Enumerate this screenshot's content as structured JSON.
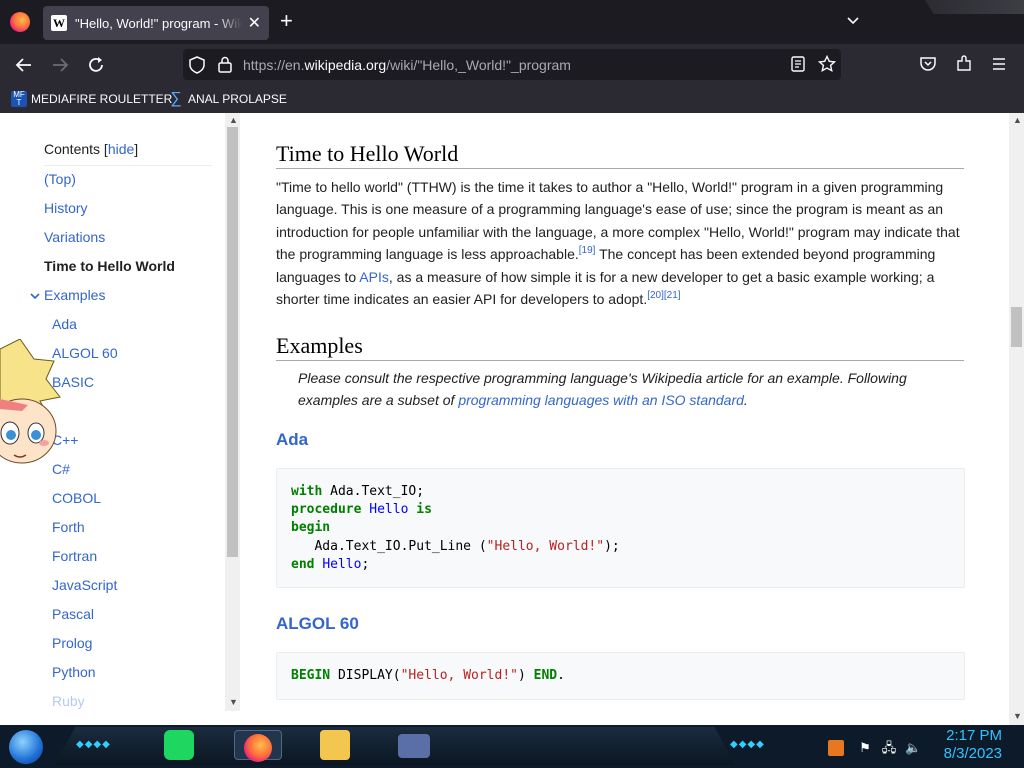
{
  "browser": {
    "tab_title": "\"Hello, World!\" program - Wikip",
    "tab_favicon": "W",
    "new_tab_symbol": "+",
    "url_prefix": "https://en.",
    "url_domain": "wikipedia.org",
    "url_path": "/wiki/\"Hello,_World!\"_program",
    "bookmarks": [
      {
        "label": "MEDIAFIRE ROULETTER",
        "icon": "mediafire-icon"
      },
      {
        "label": "ANAL PROLAPSE",
        "icon": "sigma-icon"
      }
    ]
  },
  "toc": {
    "title": "Contents",
    "hide_label": "hide",
    "items": [
      {
        "label": "(Top)"
      },
      {
        "label": "History"
      },
      {
        "label": "Variations"
      },
      {
        "label": "Time to Hello World"
      },
      {
        "label": "Examples"
      }
    ],
    "subitems": [
      "Ada",
      "ALGOL 60",
      "BASIC",
      "C++",
      "C#",
      "COBOL",
      "Forth",
      "Fortran",
      "JavaScript",
      "Pascal",
      "Prolog",
      "Python",
      "Ruby"
    ]
  },
  "article": {
    "section1_heading": "Time to Hello World",
    "section1_para": {
      "t1": "\"Time to hello world\" (TTHW) is the time it takes to author a \"Hello, World!\" program in a given programming language. This is one measure of a programming language's ease of use; since the program is meant as an introduction for people unfamiliar with the language, a more complex \"Hello, World!\" program may indicate that the programming language is less approachable.",
      "ref1": "[19]",
      "t2": " The concept has been extended beyond programming languages to ",
      "link_apis": "APIs",
      "t3": ", as a measure of how simple it is for a new developer to get a basic example working; a shorter time indicates an easier API for developers to adopt.",
      "ref2": "[20]",
      "ref3": "[21]"
    },
    "section2_heading": "Examples",
    "hatnote": {
      "t1": "Please consult the respective programming language's Wikipedia article for an example. Following examples are a subset of ",
      "link": "programming languages with an ISO standard",
      "t2": "."
    },
    "ada_heading": "Ada",
    "ada_code": {
      "l1_kw": "with",
      "l1_rest": " Ada.Text_IO;",
      "l2_kw": "procedure",
      "l2_name": "Hello",
      "l2_kw2": "is",
      "l3_kw": "begin",
      "l4_pre": "   Ada.Text_IO.Put_Line (",
      "l4_str": "\"Hello, World!\"",
      "l4_post": ");",
      "l5_kw": "end",
      "l5_name": "Hello",
      "l5_post": ";"
    },
    "algol_heading": "ALGOL 60",
    "algol_code": {
      "kw1": "BEGIN",
      "mid": " DISPLAY(",
      "str": "\"Hello, World!\"",
      "post": ") ",
      "kw2": "END",
      "end": "."
    }
  },
  "taskbar": {
    "time": "2:17 PM",
    "date": "8/3/2023"
  },
  "colors": {
    "link": "#3366cc",
    "code_keyword": "#008000",
    "code_string": "#ba2121",
    "clock": "#2fc3ff"
  }
}
